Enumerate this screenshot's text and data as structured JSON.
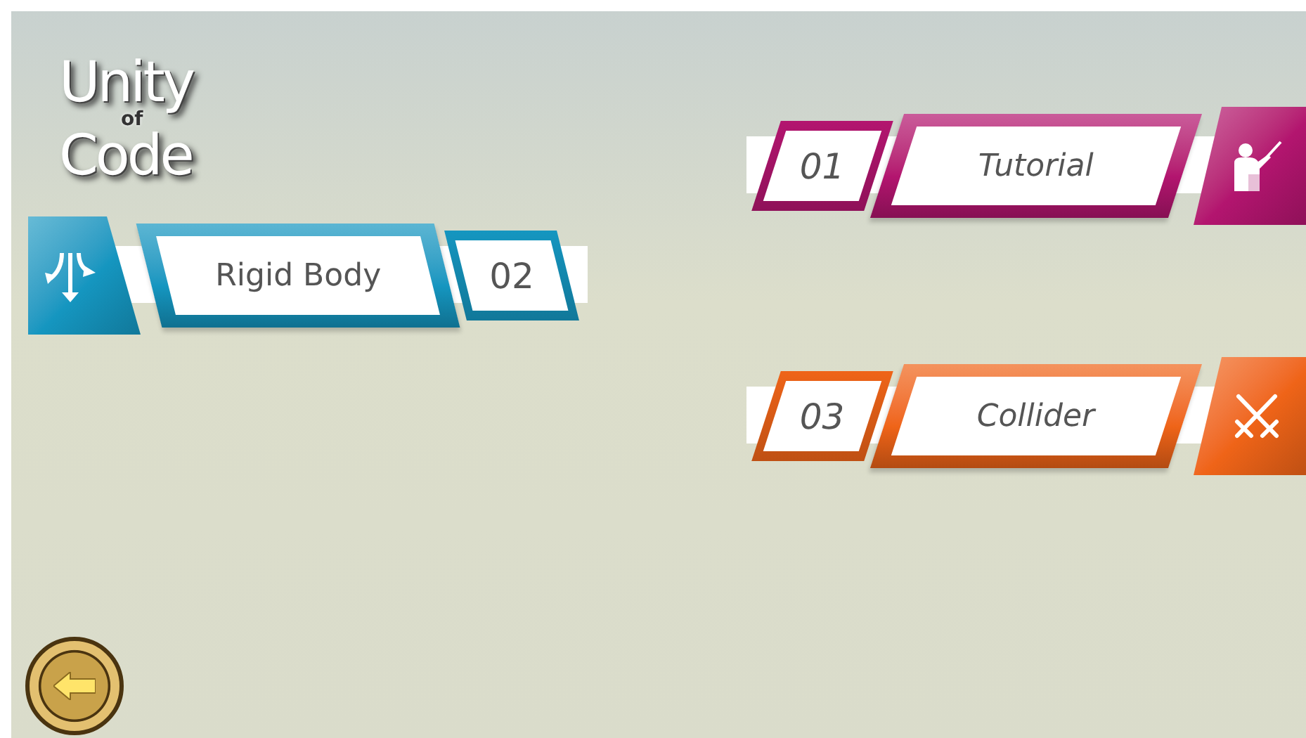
{
  "logo": {
    "words": [
      "Unity",
      "of",
      "Code"
    ]
  },
  "menu": [
    {
      "kind": "icon-right",
      "number": "01",
      "title": "Tutorial",
      "color": "#b3156f"
    },
    {
      "kind": "icon-left",
      "number": "02",
      "title": "Rigid Body",
      "color": "#1596c0"
    },
    {
      "kind": "icon-right",
      "number": "03",
      "title": "Collider",
      "color": "#ef6418"
    }
  ]
}
